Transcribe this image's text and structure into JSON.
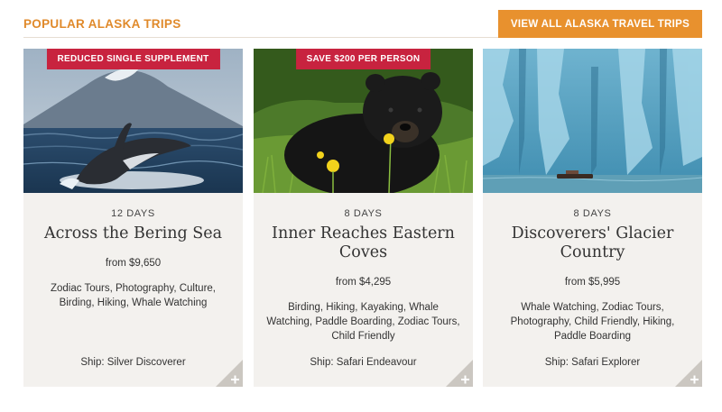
{
  "section": {
    "title": "POPULAR ALASKA TRIPS",
    "view_all_label": "VIEW ALL ALASKA TRAVEL TRIPS"
  },
  "colors": {
    "accent": "#e8912e",
    "badge": "#c8233f",
    "card_bg": "#f3f1ee"
  },
  "cards": [
    {
      "badge": "REDUCED SINGLE SUPPLEMENT",
      "image": "humpback-whale-breaching",
      "days": "12 DAYS",
      "title": "Across the Bering Sea",
      "price": "from $9,650",
      "activities": "Zodiac Tours, Photography, Culture, Birding, Hiking, Whale Watching",
      "ship": "Ship: Silver Discoverer",
      "expand_icon": "plus-icon"
    },
    {
      "badge": "SAVE $200 PER PERSON",
      "image": "black-bear-in-meadow",
      "days": "8 DAYS",
      "title": "Inner Reaches Eastern Coves",
      "price": "from $4,295",
      "activities": "Birding, Hiking, Kayaking, Whale Watching, Paddle Boarding, Zodiac Tours, Child Friendly",
      "ship": "Ship: Safari Endeavour",
      "expand_icon": "plus-icon"
    },
    {
      "badge": "",
      "image": "blue-glacier-face",
      "days": "8 DAYS",
      "title": "Discoverers' Glacier Country",
      "price": "from $5,995",
      "activities": "Whale Watching, Zodiac Tours, Photography, Child Friendly, Hiking, Paddle Boarding",
      "ship": "Ship: Safari Explorer",
      "expand_icon": "plus-icon"
    }
  ]
}
